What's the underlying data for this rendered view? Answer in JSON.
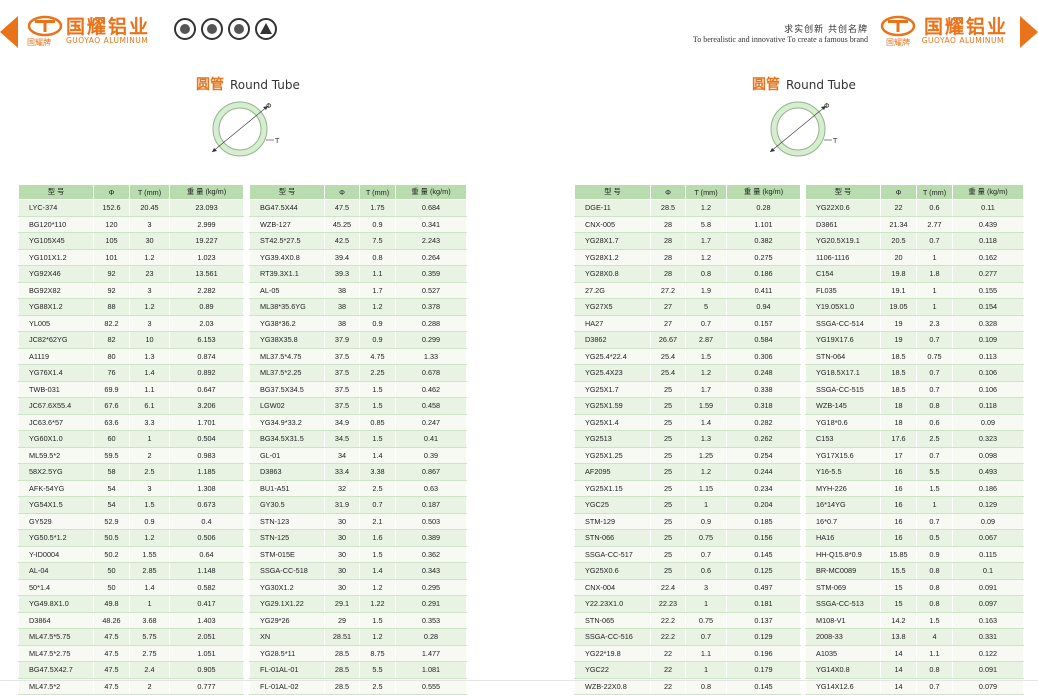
{
  "brand": {
    "name_cn": "国耀铝业",
    "name_en": "GUOYAO ALUMINUM",
    "sub_cn": "国耀牌",
    "color": "#e8731a"
  },
  "slogan": {
    "cn": "求实创新   共创名牌",
    "en": "To berealistic and innovative   To create a famous brand"
  },
  "section": {
    "title_cn": "圆管",
    "title_en": "Round Tube",
    "phi_label": "Φ",
    "t_label": "T"
  },
  "columns": [
    "型 号",
    "Φ",
    "T (mm)",
    "重 量 (kg/m)"
  ],
  "tables": [
    [
      [
        "LYC-374",
        "152.6",
        "20.45",
        "23.093"
      ],
      [
        "BG120*110",
        "120",
        "3",
        "2.999"
      ],
      [
        "YG105X45",
        "105",
        "30",
        "19.227"
      ],
      [
        "YG101X1.2",
        "101",
        "1.2",
        "1.023"
      ],
      [
        "YG92X46",
        "92",
        "23",
        "13.561"
      ],
      [
        "BG92X82",
        "92",
        "3",
        "2.282"
      ],
      [
        "YG88X1.2",
        "88",
        "1.2",
        "0.89"
      ],
      [
        "YL005",
        "82.2",
        "3",
        "2.03"
      ],
      [
        "JC82*62YG",
        "82",
        "10",
        "6.153"
      ],
      [
        "A1119",
        "80",
        "1.3",
        "0.874"
      ],
      [
        "YG76X1.4",
        "76",
        "1.4",
        "0.892"
      ],
      [
        "TWB-031",
        "69.9",
        "1.1",
        "0.647"
      ],
      [
        "JC67.6X55.4",
        "67.6",
        "6.1",
        "3.206"
      ],
      [
        "JC63.6*57",
        "63.6",
        "3.3",
        "1.701"
      ],
      [
        "YG60X1.0",
        "60",
        "1",
        "0.504"
      ],
      [
        "ML59.5*2",
        "59.5",
        "2",
        "0.983"
      ],
      [
        "58X2.5YG",
        "58",
        "2.5",
        "1.185"
      ],
      [
        "AFK-54YG",
        "54",
        "3",
        "1.308"
      ],
      [
        "YG54X1.5",
        "54",
        "1.5",
        "0.673"
      ],
      [
        "GY529",
        "52.9",
        "0.9",
        "0.4"
      ],
      [
        "YG50.5*1.2",
        "50.5",
        "1.2",
        "0.506"
      ],
      [
        "Y-ID0004",
        "50.2",
        "1.55",
        "0.64"
      ],
      [
        "AL-04",
        "50",
        "2.85",
        "1.148"
      ],
      [
        "50*1.4",
        "50",
        "1.4",
        "0.582"
      ],
      [
        "YG49.8X1.0",
        "49.8",
        "1",
        "0.417"
      ],
      [
        "D3864",
        "48.26",
        "3.68",
        "1.403"
      ],
      [
        "ML47.5*5.75",
        "47.5",
        "5.75",
        "2.051"
      ],
      [
        "ML47.5*2.75",
        "47.5",
        "2.75",
        "1.051"
      ],
      [
        "BG47.5X42.7",
        "47.5",
        "2.4",
        "0.905"
      ],
      [
        "ML47.5*2",
        "47.5",
        "2",
        "0.777"
      ]
    ],
    [
      [
        "BG47.5X44",
        "47.5",
        "1.75",
        "0.684"
      ],
      [
        "WZB-127",
        "45.25",
        "0.9",
        "0.341"
      ],
      [
        "ST42.5*27.5",
        "42.5",
        "7.5",
        "2.243"
      ],
      [
        "YG39.4X0.8",
        "39.4",
        "0.8",
        "0.264"
      ],
      [
        "RT39.3X1.1",
        "39.3",
        "1.1",
        "0.359"
      ],
      [
        "AL-05",
        "38",
        "1.7",
        "0.527"
      ],
      [
        "ML38*35.6YG",
        "38",
        "1.2",
        "0.378"
      ],
      [
        "YG38*36.2",
        "38",
        "0.9",
        "0.288"
      ],
      [
        "YG38X35.8",
        "37.9",
        "0.9",
        "0.299"
      ],
      [
        "ML37.5*4.75",
        "37.5",
        "4.75",
        "1.33"
      ],
      [
        "ML37.5*2.25",
        "37.5",
        "2.25",
        "0.678"
      ],
      [
        "BG37.5X34.5",
        "37.5",
        "1.5",
        "0.462"
      ],
      [
        "LGW02",
        "37.5",
        "1.5",
        "0.458"
      ],
      [
        "YG34.9*33.2",
        "34.9",
        "0.85",
        "0.247"
      ],
      [
        "BG34.5X31.5",
        "34.5",
        "1.5",
        "0.41"
      ],
      [
        "GL-01",
        "34",
        "1.4",
        "0.39"
      ],
      [
        "D3863",
        "33.4",
        "3.38",
        "0.867"
      ],
      [
        "BU1-A51",
        "32",
        "2.5",
        "0.63"
      ],
      [
        "GY30.5",
        "31.9",
        "0.7",
        "0.187"
      ],
      [
        "STN-123",
        "30",
        "2.1",
        "0.503"
      ],
      [
        "STN-125",
        "30",
        "1.6",
        "0.389"
      ],
      [
        "STM-015E",
        "30",
        "1.5",
        "0.362"
      ],
      [
        "SSGA-CC-518",
        "30",
        "1.4",
        "0.343"
      ],
      [
        "YG30X1.2",
        "30",
        "1.2",
        "0.295"
      ],
      [
        "YG29.1X1.22",
        "29.1",
        "1.22",
        "0.291"
      ],
      [
        "YG29*26",
        "29",
        "1.5",
        "0.353"
      ],
      [
        "XN",
        "28.51",
        "1.2",
        "0.28"
      ],
      [
        "YG28.5*11",
        "28.5",
        "8.75",
        "1.477"
      ],
      [
        "FL-01AL-01",
        "28.5",
        "5.5",
        "1.081"
      ],
      [
        "FL-01AL-02",
        "28.5",
        "2.5",
        "0.555"
      ]
    ],
    [
      [
        "DGE-11",
        "28.5",
        "1.2",
        "0.28"
      ],
      [
        "CNX-005",
        "28",
        "5.8",
        "1.101"
      ],
      [
        "YG28X1.7",
        "28",
        "1.7",
        "0.382"
      ],
      [
        "YG28X1.2",
        "28",
        "1.2",
        "0.275"
      ],
      [
        "YG28X0.8",
        "28",
        "0.8",
        "0.186"
      ],
      [
        "27.2G",
        "27.2",
        "1.9",
        "0.411"
      ],
      [
        "YG27X5",
        "27",
        "5",
        "0.94"
      ],
      [
        "HA27",
        "27",
        "0.7",
        "0.157"
      ],
      [
        "D3862",
        "26.67",
        "2.87",
        "0.584"
      ],
      [
        "YG25.4*22.4",
        "25.4",
        "1.5",
        "0.306"
      ],
      [
        "YG25.4X23",
        "25.4",
        "1.2",
        "0.248"
      ],
      [
        "YG25X1.7",
        "25",
        "1.7",
        "0.338"
      ],
      [
        "YG25X1.59",
        "25",
        "1.59",
        "0.318"
      ],
      [
        "YG25X1.4",
        "25",
        "1.4",
        "0.282"
      ],
      [
        "YG2513",
        "25",
        "1.3",
        "0.262"
      ],
      [
        "YG25X1.25",
        "25",
        "1.25",
        "0.254"
      ],
      [
        "AF2095",
        "25",
        "1.2",
        "0.244"
      ],
      [
        "YG25X1.15",
        "25",
        "1.15",
        "0.234"
      ],
      [
        "YGC25",
        "25",
        "1",
        "0.204"
      ],
      [
        "STM-129",
        "25",
        "0.9",
        "0.185"
      ],
      [
        "STN-066",
        "25",
        "0.75",
        "0.156"
      ],
      [
        "SSGA-CC-517",
        "25",
        "0.7",
        "0.145"
      ],
      [
        "YG25X0.6",
        "25",
        "0.6",
        "0.125"
      ],
      [
        "CNX-004",
        "22.4",
        "3",
        "0.497"
      ],
      [
        "Y22.23X1.0",
        "22.23",
        "1",
        "0.181"
      ],
      [
        "STN-065",
        "22.2",
        "0.75",
        "0.137"
      ],
      [
        "SSGA-CC-516",
        "22.2",
        "0.7",
        "0.129"
      ],
      [
        "YG22*19.8",
        "22",
        "1.1",
        "0.196"
      ],
      [
        "YGC22",
        "22",
        "1",
        "0.179"
      ],
      [
        "WZB-22X0.8",
        "22",
        "0.8",
        "0.145"
      ]
    ],
    [
      [
        "YG22X0.6",
        "22",
        "0.6",
        "0.11"
      ],
      [
        "D3861",
        "21.34",
        "2.77",
        "0.439"
      ],
      [
        "YG20.5X19.1",
        "20.5",
        "0.7",
        "0.118"
      ],
      [
        "1106-1116",
        "20",
        "1",
        "0.162"
      ],
      [
        "C154",
        "19.8",
        "1.8",
        "0.277"
      ],
      [
        "FL035",
        "19.1",
        "1",
        "0.155"
      ],
      [
        "Y19.05X1.0",
        "19.05",
        "1",
        "0.154"
      ],
      [
        "SSGA-CC-514",
        "19",
        "2.3",
        "0.328"
      ],
      [
        "YG19X17.6",
        "19",
        "0.7",
        "0.109"
      ],
      [
        "STN-064",
        "18.5",
        "0.75",
        "0.113"
      ],
      [
        "YG18.5X17.1",
        "18.5",
        "0.7",
        "0.106"
      ],
      [
        "SSGA-CC-515",
        "18.5",
        "0.7",
        "0.106"
      ],
      [
        "WZB-145",
        "18",
        "0.8",
        "0.118"
      ],
      [
        "YG18*0.6",
        "18",
        "0.6",
        "0.09"
      ],
      [
        "C153",
        "17.6",
        "2.5",
        "0.323"
      ],
      [
        "YG17X15.6",
        "17",
        "0.7",
        "0.098"
      ],
      [
        "Y16-5.5",
        "16",
        "5.5",
        "0.493"
      ],
      [
        "MYH-226",
        "16",
        "1.5",
        "0.186"
      ],
      [
        "16*14YG",
        "16",
        "1",
        "0.129"
      ],
      [
        "16*0.7",
        "16",
        "0.7",
        "0.09"
      ],
      [
        "HA16",
        "16",
        "0.5",
        "0.067"
      ],
      [
        "HH-Q15.8*0.9",
        "15.85",
        "0.9",
        "0.115"
      ],
      [
        "BR-MC0089",
        "15.5",
        "0.8",
        "0.1"
      ],
      [
        "STM-069",
        "15",
        "0.8",
        "0.091"
      ],
      [
        "SSGA-CC-513",
        "15",
        "0.8",
        "0.097"
      ],
      [
        "M108-V1",
        "14.2",
        "1.5",
        "0.163"
      ],
      [
        "2008-33",
        "13.8",
        "4",
        "0.331"
      ],
      [
        "A1035",
        "14",
        "1.1",
        "0.122"
      ],
      [
        "YG14X0.8",
        "14",
        "0.8",
        "0.091"
      ],
      [
        "YG14X12.6",
        "14",
        "0.7",
        "0.079"
      ]
    ]
  ]
}
